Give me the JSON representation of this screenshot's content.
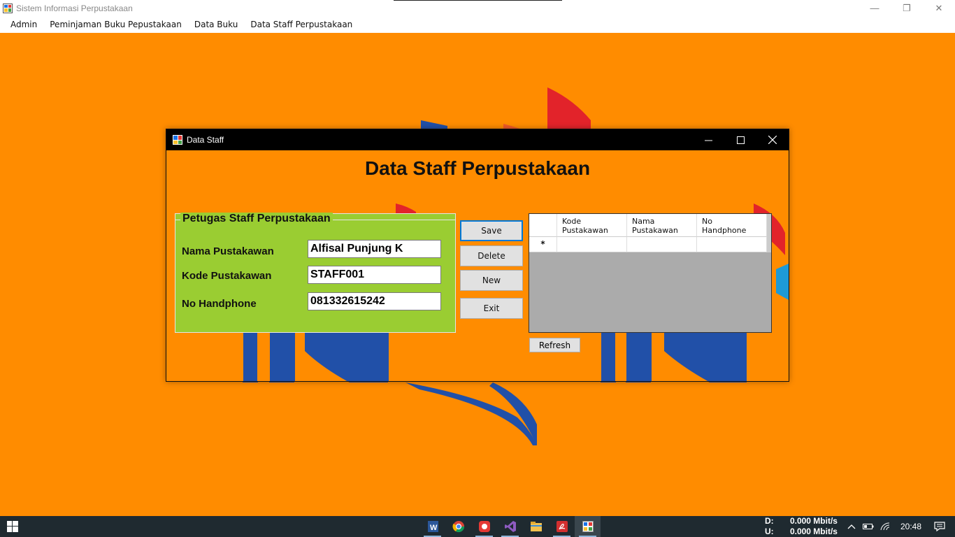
{
  "app": {
    "title": "Sistem Informasi Perpustakaan"
  },
  "menu": [
    "Admin",
    "Peminjaman Buku Pepustakaan",
    "Data Buku",
    "Data Staff Perpustakaan"
  ],
  "dialog": {
    "title": "Data Staff",
    "heading": "Data Staff Perpustakaan",
    "group": {
      "legend": "Petugas Staff Perpustakaan",
      "fields": [
        {
          "label": "Nama Pustakawan",
          "value": "Alfisal Punjung K"
        },
        {
          "label": "Kode Pustakawan",
          "value": "STAFF001"
        },
        {
          "label": "No Handphone",
          "value": "081332615242"
        }
      ]
    },
    "buttons": {
      "save": "Save",
      "delete": "Delete",
      "new": "New",
      "exit": "Exit",
      "refresh": "Refresh"
    },
    "grid": {
      "columns": [
        {
          "line1": "Kode",
          "line2": "Pustakawan"
        },
        {
          "line1": "Nama",
          "line2": "Pustakawan"
        },
        {
          "line1": "No",
          "line2": "Handphone"
        }
      ],
      "new_row_marker": "*"
    }
  },
  "taskbar": {
    "net_down_label": "D:",
    "net_down_value": "0.000 Mbit/s",
    "net_up_label": "U:",
    "net_up_value": "0.000 Mbit/s",
    "clock": "20:48",
    "apps": [
      "word-icon",
      "chrome-icon",
      "screen-recorder-icon",
      "visual-studio-icon",
      "file-explorer-icon",
      "pdf-reader-icon",
      "library-app-icon"
    ]
  },
  "colors": {
    "background": "#ff8c00",
    "group_panel": "#9acd32",
    "accent_blue": "#2150a8",
    "accent_red": "#e2232a"
  }
}
